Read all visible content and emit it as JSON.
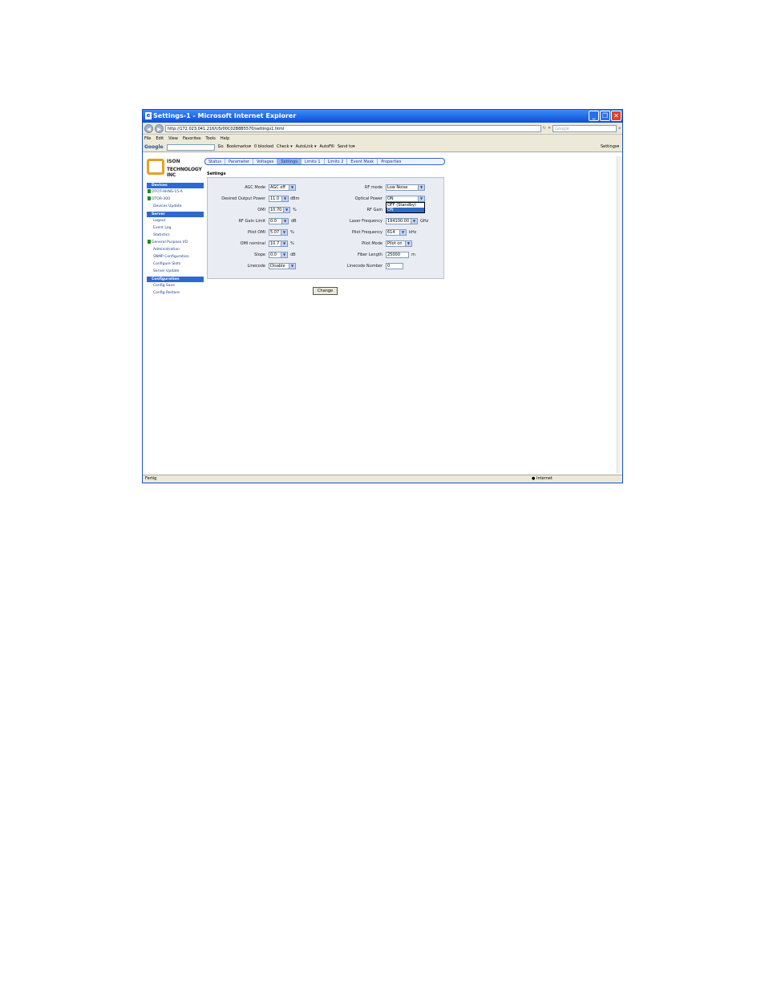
{
  "window": {
    "title": "Settings-1 - Microsoft Internet Explorer"
  },
  "browser": {
    "address": "http://172.023.041.216/US/00C02B8B5570/settings1.html",
    "search_placeholder": "Google",
    "menu": [
      "File",
      "Edit",
      "View",
      "Favorites",
      "Tools",
      "Help"
    ],
    "google_toolbar": {
      "logo": "Google",
      "items": [
        "Go",
        "Bookmarks▾",
        "0 blocked",
        "Check ▾",
        "AutoLink ▾",
        "AutoFill",
        "Send to▾"
      ],
      "settings": "Settings▾"
    },
    "status": {
      "left": "Fertig",
      "zone": "Internet"
    }
  },
  "logo": {
    "line1": "ISON",
    "line2": "TECHNOLOGY INC"
  },
  "tabs": [
    "Status",
    "Parameter",
    "Voltages",
    "Settings",
    "Limits 1",
    "Limits 2",
    "Event Mask",
    "Properties"
  ],
  "sidebar": {
    "devices_header": "Devices",
    "devices": [
      "OTOT-HHNS-15-A",
      "OTOR-300"
    ],
    "devices_update": "Devices Update",
    "server_header": "Server",
    "server_items": [
      "Logout",
      "Event Log",
      "Statistics"
    ],
    "gpio": "General Purpose I/O",
    "server_items2": [
      "Administration",
      "SNMP Configuration",
      "Configure Slots",
      "Server Update"
    ],
    "config_header": "Configuration",
    "config_items": [
      "Config Save",
      "Config Restore"
    ]
  },
  "settings": {
    "title": "Settings",
    "left": [
      {
        "label": "AGC Mode",
        "value": "AGC off",
        "unit": ""
      },
      {
        "label": "Desired Output Power",
        "value": "11.0",
        "unit": "dBm"
      },
      {
        "label": "OMI",
        "value": "10.70",
        "unit": "%"
      },
      {
        "label": "RF Gain Limit",
        "value": "0.0",
        "unit": "dB"
      },
      {
        "label": "Pilot OMI",
        "value": "5.07",
        "unit": "%"
      },
      {
        "label": "OMI nominal",
        "value": "10.7",
        "unit": "%"
      },
      {
        "label": "Slope",
        "value": "0.0",
        "unit": "dB"
      },
      {
        "label": "Linecode",
        "value": "Disable",
        "unit": ""
      }
    ],
    "right": [
      {
        "label": "RF mode",
        "value": "Low Noise",
        "unit": ""
      },
      {
        "label": "Optical Power",
        "value": "ON",
        "unit": ""
      },
      {
        "label": "RF Gain",
        "value": "",
        "unit": ""
      },
      {
        "label": "Laser Frequency",
        "value": "194100.00",
        "unit": "GHz"
      },
      {
        "label": "Pilot Frequency",
        "value": "614",
        "unit": "kHz"
      },
      {
        "label": "Pilot Mode",
        "value": "Pilot on",
        "unit": ""
      },
      {
        "label": "Fiber Length",
        "value": "25000",
        "unit": "m"
      },
      {
        "label": "Linecode Number",
        "value": "0",
        "unit": ""
      }
    ],
    "optical_power_options": [
      "OFF (Standby)",
      "ON"
    ],
    "change_button": "Change"
  }
}
